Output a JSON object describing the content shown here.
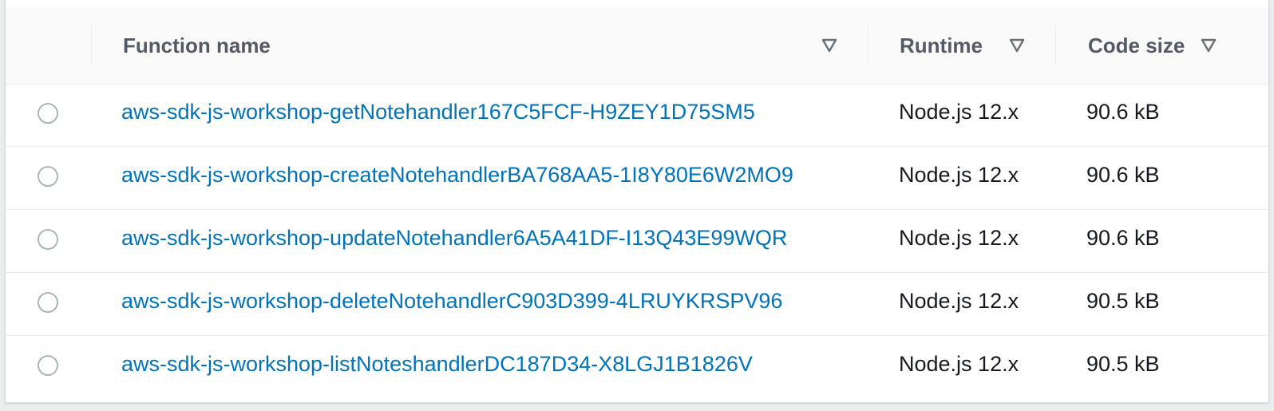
{
  "table": {
    "columns": [
      {
        "label": "Function name",
        "sort_icon": "sort-caret-down-icon"
      },
      {
        "label": "Runtime",
        "sort_icon": "sort-caret-down-icon"
      },
      {
        "label": "Code size",
        "sort_icon": "sort-caret-down-icon"
      }
    ],
    "rows": [
      {
        "name": "aws-sdk-js-workshop-getNotehandler167C5FCF-H9ZEY1D75SM5",
        "runtime": "Node.js 12.x",
        "code_size": "90.6 kB",
        "selected": false
      },
      {
        "name": "aws-sdk-js-workshop-createNotehandlerBA768AA5-1I8Y80E6W2MO9",
        "runtime": "Node.js 12.x",
        "code_size": "90.6 kB",
        "selected": false
      },
      {
        "name": "aws-sdk-js-workshop-updateNotehandler6A5A41DF-I13Q43E99WQR",
        "runtime": "Node.js 12.x",
        "code_size": "90.6 kB",
        "selected": false
      },
      {
        "name": "aws-sdk-js-workshop-deleteNotehandlerC903D399-4LRUYKRSPV96",
        "runtime": "Node.js 12.x",
        "code_size": "90.5 kB",
        "selected": false
      },
      {
        "name": "aws-sdk-js-workshop-listNoteshandlerDC187D34-X8LGJ1B1826V",
        "runtime": "Node.js 12.x",
        "code_size": "90.5 kB",
        "selected": false
      }
    ]
  },
  "colors": {
    "link": "#0073bb",
    "header_text": "#545b64",
    "body_text": "#16191f",
    "header_bg": "#fafafa",
    "border": "#eaeded"
  }
}
